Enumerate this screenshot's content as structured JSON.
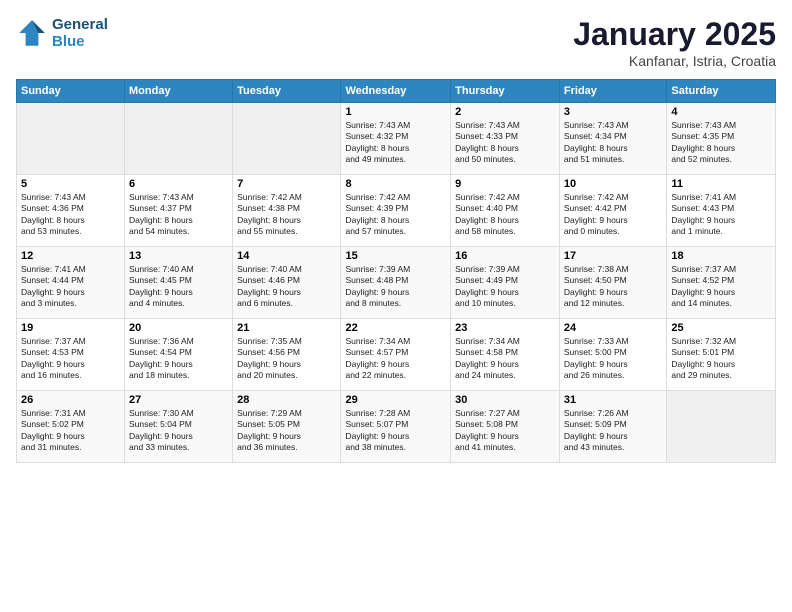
{
  "header": {
    "logo_line1": "General",
    "logo_line2": "Blue",
    "month": "January 2025",
    "location": "Kanfanar, Istria, Croatia"
  },
  "weekdays": [
    "Sunday",
    "Monday",
    "Tuesday",
    "Wednesday",
    "Thursday",
    "Friday",
    "Saturday"
  ],
  "weeks": [
    [
      {
        "day": "",
        "content": ""
      },
      {
        "day": "",
        "content": ""
      },
      {
        "day": "",
        "content": ""
      },
      {
        "day": "1",
        "content": "Sunrise: 7:43 AM\nSunset: 4:32 PM\nDaylight: 8 hours\nand 49 minutes."
      },
      {
        "day": "2",
        "content": "Sunrise: 7:43 AM\nSunset: 4:33 PM\nDaylight: 8 hours\nand 50 minutes."
      },
      {
        "day": "3",
        "content": "Sunrise: 7:43 AM\nSunset: 4:34 PM\nDaylight: 8 hours\nand 51 minutes."
      },
      {
        "day": "4",
        "content": "Sunrise: 7:43 AM\nSunset: 4:35 PM\nDaylight: 8 hours\nand 52 minutes."
      }
    ],
    [
      {
        "day": "5",
        "content": "Sunrise: 7:43 AM\nSunset: 4:36 PM\nDaylight: 8 hours\nand 53 minutes."
      },
      {
        "day": "6",
        "content": "Sunrise: 7:43 AM\nSunset: 4:37 PM\nDaylight: 8 hours\nand 54 minutes."
      },
      {
        "day": "7",
        "content": "Sunrise: 7:42 AM\nSunset: 4:38 PM\nDaylight: 8 hours\nand 55 minutes."
      },
      {
        "day": "8",
        "content": "Sunrise: 7:42 AM\nSunset: 4:39 PM\nDaylight: 8 hours\nand 57 minutes."
      },
      {
        "day": "9",
        "content": "Sunrise: 7:42 AM\nSunset: 4:40 PM\nDaylight: 8 hours\nand 58 minutes."
      },
      {
        "day": "10",
        "content": "Sunrise: 7:42 AM\nSunset: 4:42 PM\nDaylight: 9 hours\nand 0 minutes."
      },
      {
        "day": "11",
        "content": "Sunrise: 7:41 AM\nSunset: 4:43 PM\nDaylight: 9 hours\nand 1 minute."
      }
    ],
    [
      {
        "day": "12",
        "content": "Sunrise: 7:41 AM\nSunset: 4:44 PM\nDaylight: 9 hours\nand 3 minutes."
      },
      {
        "day": "13",
        "content": "Sunrise: 7:40 AM\nSunset: 4:45 PM\nDaylight: 9 hours\nand 4 minutes."
      },
      {
        "day": "14",
        "content": "Sunrise: 7:40 AM\nSunset: 4:46 PM\nDaylight: 9 hours\nand 6 minutes."
      },
      {
        "day": "15",
        "content": "Sunrise: 7:39 AM\nSunset: 4:48 PM\nDaylight: 9 hours\nand 8 minutes."
      },
      {
        "day": "16",
        "content": "Sunrise: 7:39 AM\nSunset: 4:49 PM\nDaylight: 9 hours\nand 10 minutes."
      },
      {
        "day": "17",
        "content": "Sunrise: 7:38 AM\nSunset: 4:50 PM\nDaylight: 9 hours\nand 12 minutes."
      },
      {
        "day": "18",
        "content": "Sunrise: 7:37 AM\nSunset: 4:52 PM\nDaylight: 9 hours\nand 14 minutes."
      }
    ],
    [
      {
        "day": "19",
        "content": "Sunrise: 7:37 AM\nSunset: 4:53 PM\nDaylight: 9 hours\nand 16 minutes."
      },
      {
        "day": "20",
        "content": "Sunrise: 7:36 AM\nSunset: 4:54 PM\nDaylight: 9 hours\nand 18 minutes."
      },
      {
        "day": "21",
        "content": "Sunrise: 7:35 AM\nSunset: 4:56 PM\nDaylight: 9 hours\nand 20 minutes."
      },
      {
        "day": "22",
        "content": "Sunrise: 7:34 AM\nSunset: 4:57 PM\nDaylight: 9 hours\nand 22 minutes."
      },
      {
        "day": "23",
        "content": "Sunrise: 7:34 AM\nSunset: 4:58 PM\nDaylight: 9 hours\nand 24 minutes."
      },
      {
        "day": "24",
        "content": "Sunrise: 7:33 AM\nSunset: 5:00 PM\nDaylight: 9 hours\nand 26 minutes."
      },
      {
        "day": "25",
        "content": "Sunrise: 7:32 AM\nSunset: 5:01 PM\nDaylight: 9 hours\nand 29 minutes."
      }
    ],
    [
      {
        "day": "26",
        "content": "Sunrise: 7:31 AM\nSunset: 5:02 PM\nDaylight: 9 hours\nand 31 minutes."
      },
      {
        "day": "27",
        "content": "Sunrise: 7:30 AM\nSunset: 5:04 PM\nDaylight: 9 hours\nand 33 minutes."
      },
      {
        "day": "28",
        "content": "Sunrise: 7:29 AM\nSunset: 5:05 PM\nDaylight: 9 hours\nand 36 minutes."
      },
      {
        "day": "29",
        "content": "Sunrise: 7:28 AM\nSunset: 5:07 PM\nDaylight: 9 hours\nand 38 minutes."
      },
      {
        "day": "30",
        "content": "Sunrise: 7:27 AM\nSunset: 5:08 PM\nDaylight: 9 hours\nand 41 minutes."
      },
      {
        "day": "31",
        "content": "Sunrise: 7:26 AM\nSunset: 5:09 PM\nDaylight: 9 hours\nand 43 minutes."
      },
      {
        "day": "",
        "content": ""
      }
    ]
  ]
}
